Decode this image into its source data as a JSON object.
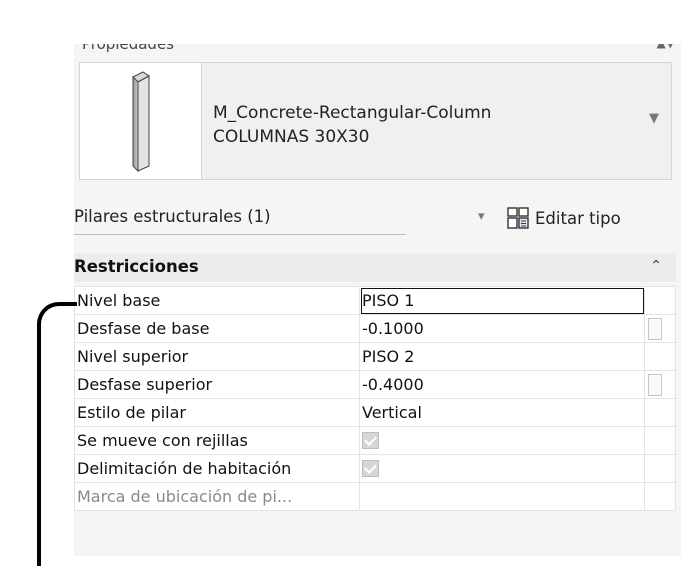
{
  "panel": {
    "header_partial": "Propiedades",
    "type_selector": {
      "family": "M_Concrete-Rectangular-Column",
      "type": "COLUMNAS 30X30",
      "thumbnail_icon": "column-thumbnail-icon",
      "dropdown_icon": "chevron-down-icon"
    },
    "filter": {
      "label": "Pilares estructurales (1)",
      "dropdown_icon": "chevron-down-icon",
      "edit_type_label": "Editar tipo",
      "edit_type_icon": "edit-type-icon"
    },
    "section": {
      "title": "Restricciones",
      "toggle_icon": "collapse-up-icon"
    },
    "rows": [
      {
        "name": "Nivel base",
        "value": "PISO 1"
      },
      {
        "name": "Desfase de base",
        "value": "-0.1000"
      },
      {
        "name": "Nivel superior",
        "value": "PISO 2"
      },
      {
        "name": "Desfase superior",
        "value": "-0.4000"
      },
      {
        "name": "Estilo de pilar",
        "value": "Vertical"
      },
      {
        "name": "Se mueve con rejillas",
        "checked": true
      },
      {
        "name": "Delimitación de habitación",
        "checked": true
      },
      {
        "name": "Marca de ubicación de pi...",
        "value": ""
      }
    ]
  },
  "colors": {
    "panel_bg": "#f5f5f5",
    "section_bg": "#ececec",
    "checkbox_bg": "#d6d6d6",
    "annotation_bracket": "#000000"
  }
}
